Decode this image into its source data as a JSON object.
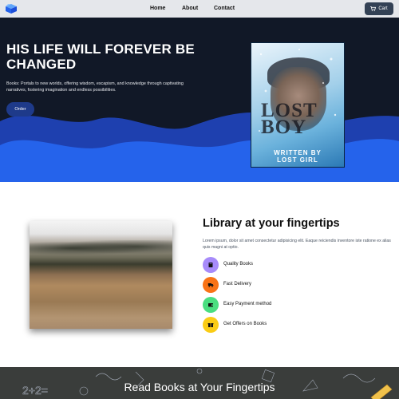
{
  "nav": {
    "logo_icon": "box-logo-icon",
    "links": [
      {
        "label": "Home"
      },
      {
        "label": "About"
      },
      {
        "label": "Contact"
      }
    ],
    "cart_icon": "cart-icon",
    "cart_label": "Cart"
  },
  "hero": {
    "title": "HIS LIFE WILL FOREVER BE CHANGED",
    "description": "Books: Portals to new worlds, offering wisdom, escapism, and knowledge through captivating narratives, fostering imagination and endless possibilities.",
    "order_label": "Order",
    "book": {
      "title_line1": "LOST",
      "title_line2": "BOY",
      "written_by": "WRITTEN BY",
      "author": "LOST GIRL"
    }
  },
  "library": {
    "title": "Library at your fingertips",
    "description": "Lorem ipsum, dolor sit amet consectetur adipisicing elit. Eaque reiciendis inventore iste ratione ex alias quis magni at optio.",
    "features": [
      {
        "label": "Quality Books",
        "icon": "book-icon",
        "color": "#a78bfa"
      },
      {
        "label": "Fast Delivery",
        "icon": "truck-icon",
        "color": "#f97316"
      },
      {
        "label": "Easy Payment method",
        "icon": "wallet-icon",
        "color": "#4ade80"
      },
      {
        "label": "Get Offers on Books",
        "icon": "gift-icon",
        "color": "#facc15"
      }
    ]
  },
  "banner": {
    "title": "Read Books at Your Fingertips"
  },
  "colors": {
    "nav_bg": "#e5e7eb",
    "hero_bg": "#111827",
    "wave_dark": "#1e40af",
    "wave_light": "#2563eb",
    "cart_bg": "#334155",
    "order_bg": "#1e3a8a"
  }
}
